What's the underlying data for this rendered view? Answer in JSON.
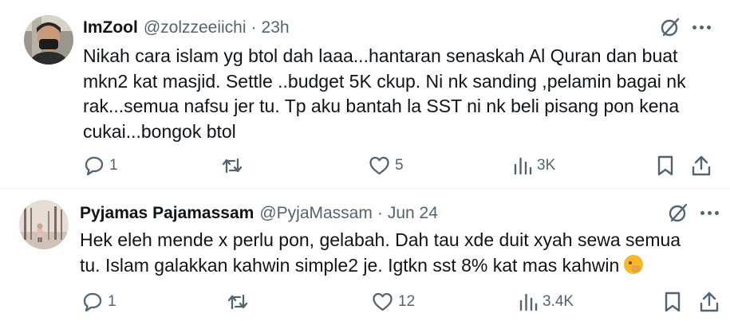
{
  "tweets": [
    {
      "display_name": "ImZool",
      "handle": "@zolzzeeiichi",
      "separator": "·",
      "timestamp": "23h",
      "text": "Nikah cara islam yg btol dah laaa...hantaran senaskah Al Quran dan buat\nmkn2 kat masjid. Settle ..budget 5K ckup. Ni nk sanding ,pelamin bagai nk\nrak...semua nafsu jer tu. Tp aku bantah la SST ni  nk beli pisang pon kena\ncukai...bongok btol",
      "replies": "1",
      "reposts": "",
      "likes": "5",
      "views": "3K"
    },
    {
      "display_name": "Pyjamas Pajamassam",
      "handle": "@PyjaMassam",
      "separator": "·",
      "timestamp": "Jun 24",
      "text": "Hek eleh mende x perlu pon, gelabah. Dah tau xde duit xyah sewa semua\ntu. Islam galakkan kahwin simple2 je. Igtkn sst 8% kat mas kahwin",
      "emoji": "face-with-hand-over-mouth",
      "replies": "1",
      "reposts": "",
      "likes": "12",
      "views": "3.4K"
    }
  ],
  "colors": {
    "text_primary": "#0f1419",
    "text_secondary": "#536471",
    "divider": "#eff3f4",
    "background": "#ffffff"
  },
  "icons": [
    "grok-icon",
    "more-icon",
    "reply-icon",
    "repost-icon",
    "like-icon",
    "views-icon",
    "bookmark-icon",
    "share-icon"
  ]
}
